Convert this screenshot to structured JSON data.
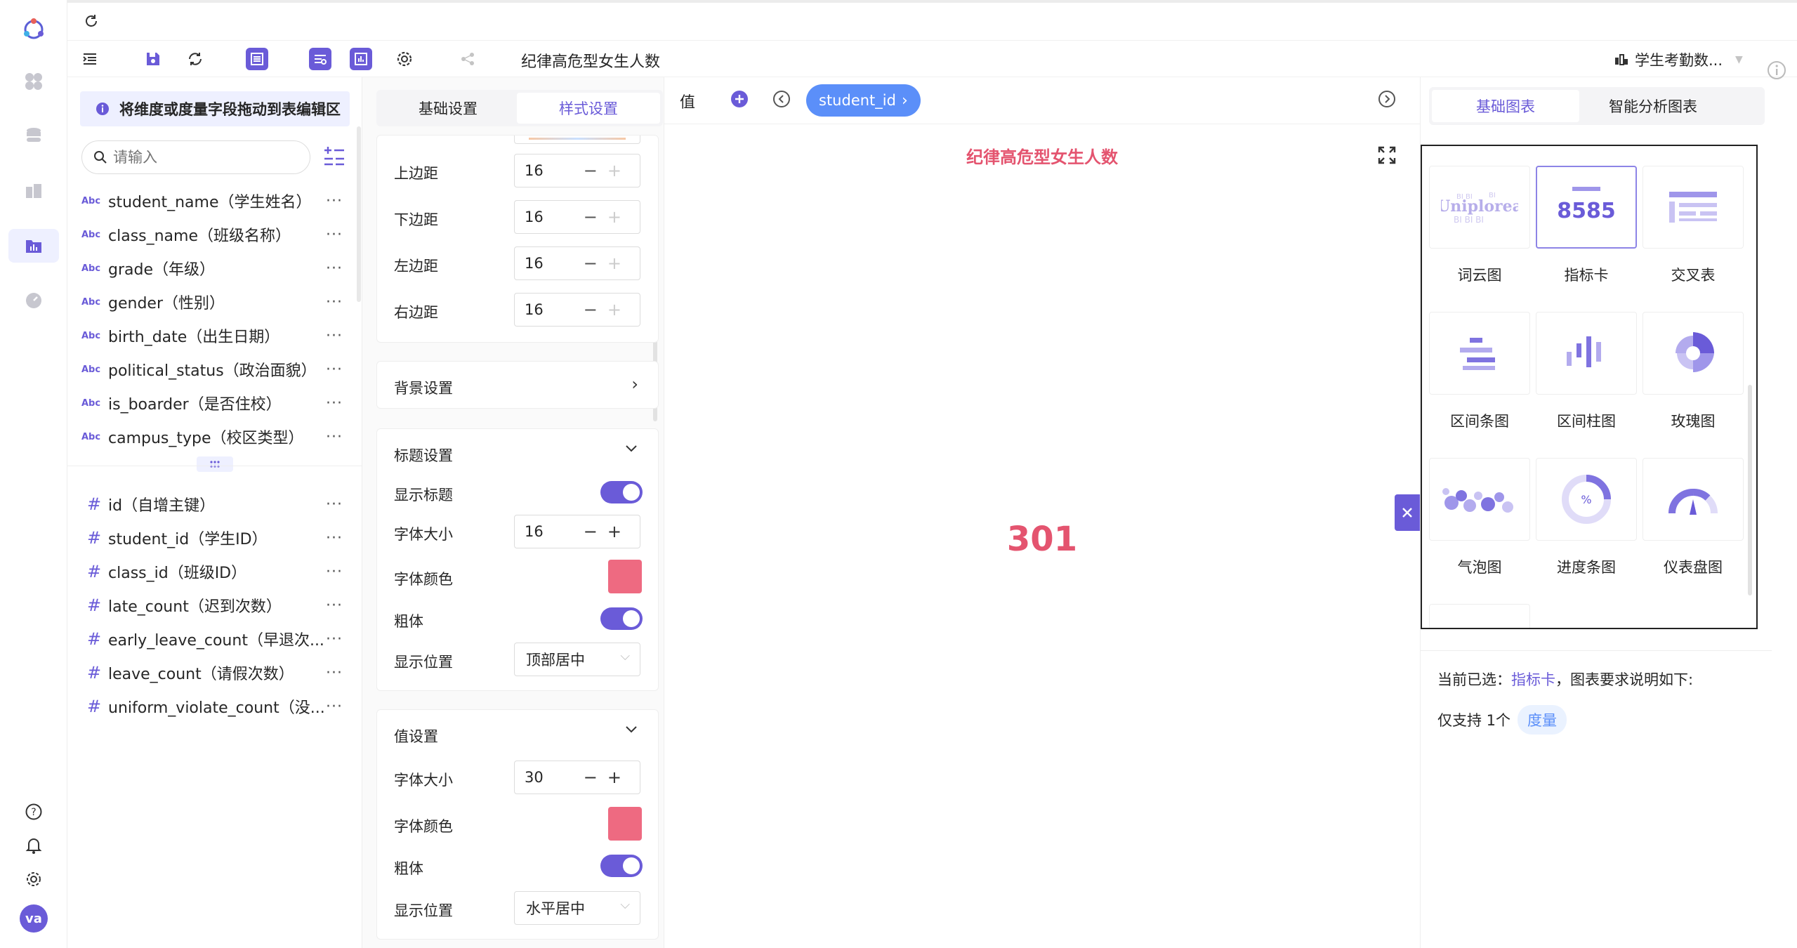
{
  "app": {
    "chart_title": "纪律高危型女生人数",
    "dataset": "学生考勤数...",
    "avatar": "va"
  },
  "colors": {
    "accent": "#6a5bd8",
    "pill": "#5b8ff9",
    "value": "#e4546f"
  },
  "fields": {
    "hint": "将维度或度量字段拖动到表编辑区",
    "search_placeholder": "请输入",
    "dimension_badge": "Abc",
    "dimensions": [
      "student_name（学生姓名）",
      "class_name（班级名称）",
      "grade（年级）",
      "gender（性别）",
      "birth_date（出生日期）",
      "political_status（政治面貌）",
      "is_boarder（是否住校）",
      "campus_type（校区类型）"
    ],
    "measures": [
      "id（自增主键）",
      "student_id（学生ID）",
      "class_id（班级ID）",
      "late_count（迟到次数）",
      "early_leave_count（早退次...",
      "leave_count（请假次数）",
      "uniform_violate_count（没..."
    ],
    "more_glyph": "···"
  },
  "style_panel": {
    "tabs": [
      "基础设置",
      "样式设置"
    ],
    "margins": [
      {
        "label": "上边距",
        "value": "16"
      },
      {
        "label": "下边距",
        "value": "16"
      },
      {
        "label": "左边距",
        "value": "16"
      },
      {
        "label": "右边距",
        "value": "16"
      }
    ],
    "background": {
      "label": "背景设置"
    },
    "title_settings": {
      "header": "标题设置",
      "show_title": "显示标题",
      "font_size_label": "字体大小",
      "font_size": "16",
      "font_color_label": "字体颜色",
      "bold_label": "粗体",
      "position_label": "显示位置",
      "position": "顶部居中"
    },
    "value_settings": {
      "header": "值设置",
      "font_size_label": "字体大小",
      "font_size": "30",
      "font_color_label": "字体颜色",
      "bold_label": "粗体",
      "position_label": "显示位置",
      "position": "水平居中"
    }
  },
  "canvas": {
    "value_label": "值",
    "pill": "student_id",
    "title": "纪律高危型女生人数",
    "kpi_value": "301"
  },
  "chart_types": {
    "tabs": [
      "基础图表",
      "智能分析图表"
    ],
    "items": [
      {
        "label": "词云图",
        "icon": "word-cloud-icon"
      },
      {
        "label": "指标卡",
        "icon": "kpi-card-icon",
        "preview": "8585"
      },
      {
        "label": "交叉表",
        "icon": "cross-table-icon"
      },
      {
        "label": "区间条图",
        "icon": "range-bar-icon"
      },
      {
        "label": "区间柱图",
        "icon": "range-column-icon"
      },
      {
        "label": "玫瑰图",
        "icon": "rose-chart-icon"
      },
      {
        "label": "气泡图",
        "icon": "bubble-chart-icon"
      },
      {
        "label": "进度条图",
        "icon": "progress-chart-icon",
        "preview": "%"
      },
      {
        "label": "仪表盘图",
        "icon": "gauge-chart-icon"
      }
    ],
    "current_prefix": "当前已选：",
    "current": "指标卡",
    "current_suffix": "，图表要求说明如下:",
    "support_prefix": "仅支持 1个",
    "support_tag": "度量"
  }
}
